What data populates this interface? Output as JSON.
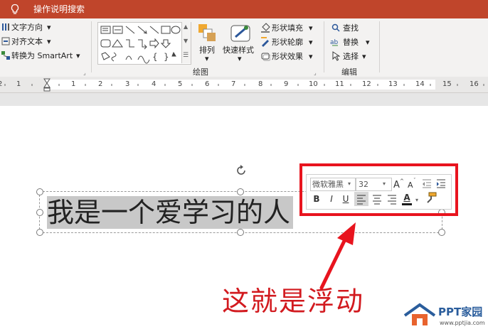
{
  "titlebar": {
    "search_label": "操作说明搜索",
    "color": "#c0452b"
  },
  "ribbon": {
    "paragraph": {
      "text_direction": "文字方向",
      "align_text": "对齐文本",
      "convert_smartart": "转换为 SmartArt"
    },
    "drawing": {
      "arrange": "排列",
      "quick_styles": "快速样式",
      "shape_fill": "形状填充",
      "shape_outline": "形状轮廓",
      "shape_effects": "形状效果",
      "group_label": "绘图"
    },
    "editing": {
      "find": "查找",
      "replace": "替换",
      "select": "选择",
      "group_label": "编辑"
    }
  },
  "ruler": {
    "numbers": [
      "1",
      "2",
      "1",
      "2",
      "3",
      "4",
      "5",
      "6",
      "7",
      "8",
      "9",
      "10",
      "11",
      "12",
      "13",
      "14",
      "15",
      "16"
    ]
  },
  "slide": {
    "text": "我是一个爱学习的人"
  },
  "floating_toolbar": {
    "font": "微软雅黑",
    "size": "32",
    "bold": "B",
    "italic": "I",
    "underline": "U",
    "font_color_letter": "A"
  },
  "annotation": {
    "caption": "这就是浮动",
    "color": "#d21a1f"
  },
  "logo": {
    "name": "PPT家园",
    "url": "www.pptjia.com"
  }
}
